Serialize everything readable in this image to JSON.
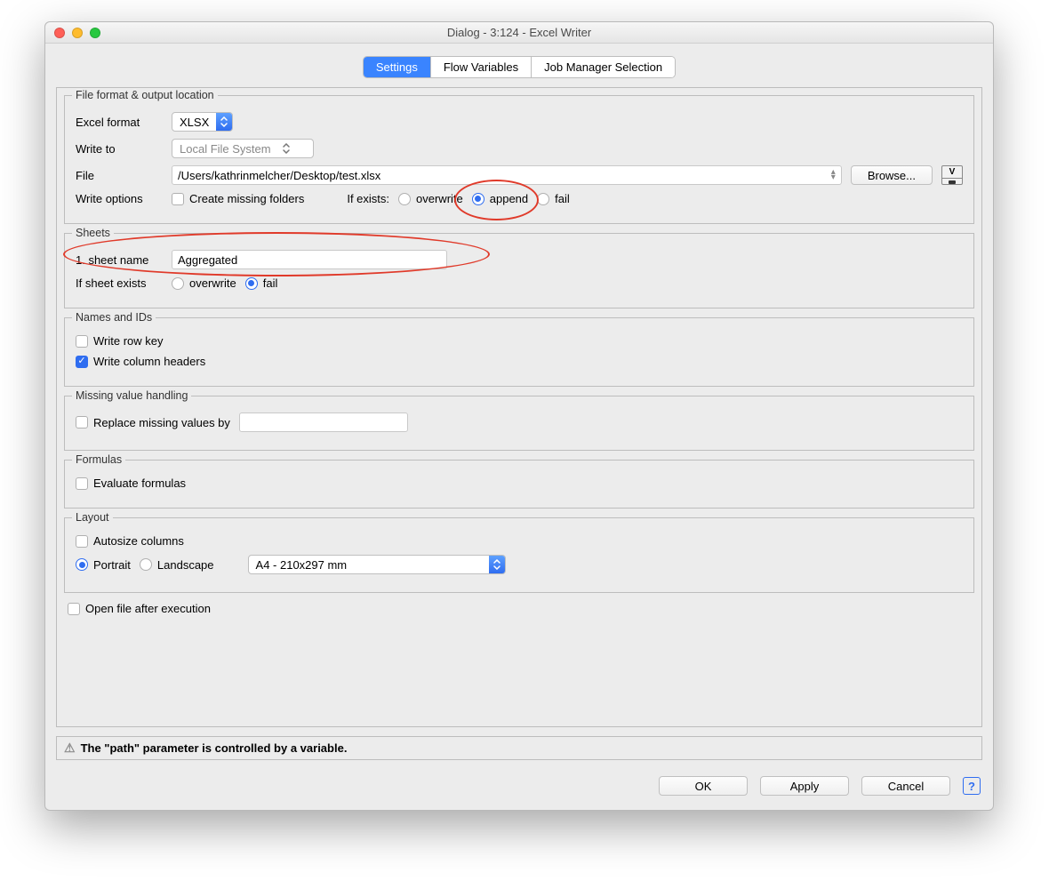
{
  "window": {
    "title": "Dialog - 3:124 - Excel Writer"
  },
  "tabs": {
    "settings": "Settings",
    "flowvars": "Flow Variables",
    "jobmgr": "Job Manager Selection"
  },
  "fileformat": {
    "legend": "File format & output location",
    "excel_format_label": "Excel format",
    "excel_format_value": "XLSX",
    "write_to_label": "Write to",
    "write_to_value": "Local File System",
    "file_label": "File",
    "file_value": "/Users/kathrinmelcher/Desktop/test.xlsx",
    "browse": "Browse...",
    "write_options_label": "Write options",
    "create_missing": "Create missing folders",
    "if_exists_label": "If exists:",
    "overwrite": "overwrite",
    "append": "append",
    "fail": "fail"
  },
  "sheets": {
    "legend": "Sheets",
    "sheet_name_label": "1. sheet name",
    "sheet_name_value": "Aggregated",
    "if_sheet_exists_label": "If sheet exists",
    "overwrite": "overwrite",
    "fail": "fail"
  },
  "names": {
    "legend": "Names and IDs",
    "write_row_key": "Write row key",
    "write_col_headers": "Write column headers"
  },
  "missing": {
    "legend": "Missing value handling",
    "replace_label": "Replace missing values by"
  },
  "formulas": {
    "legend": "Formulas",
    "evaluate": "Evaluate formulas"
  },
  "layout": {
    "legend": "Layout",
    "autosize": "Autosize columns",
    "portrait": "Portrait",
    "landscape": "Landscape",
    "paper": "A4 - 210x297 mm"
  },
  "open_after": "Open file after execution",
  "status": "The \"path\" parameter is controlled by a variable.",
  "footer": {
    "ok": "OK",
    "apply": "Apply",
    "cancel": "Cancel"
  }
}
